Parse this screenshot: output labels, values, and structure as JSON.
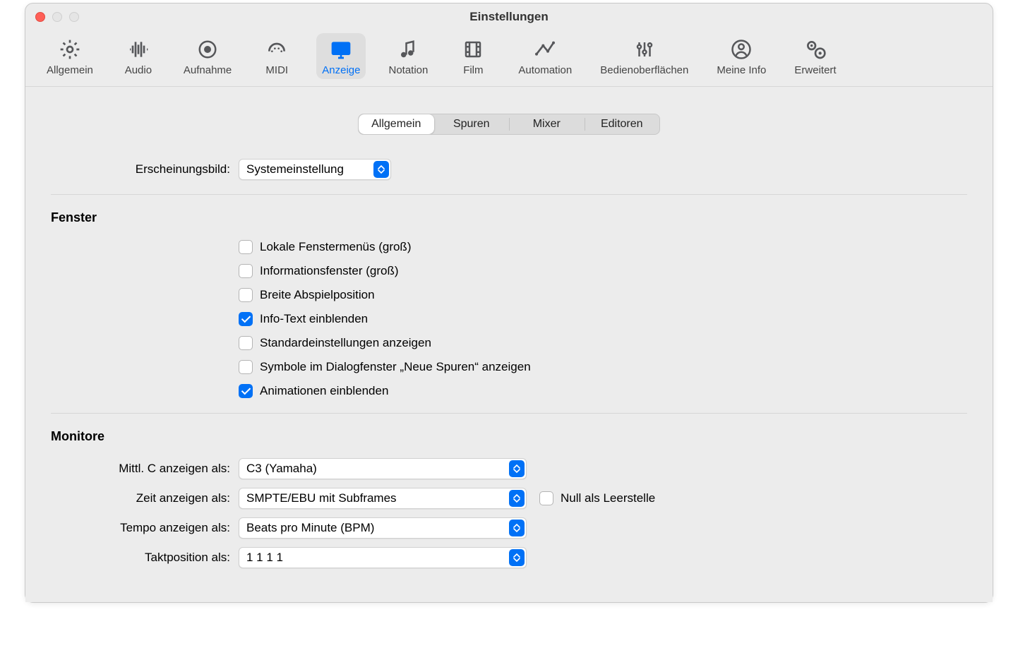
{
  "window": {
    "title": "Einstellungen"
  },
  "toolbar": {
    "items": [
      {
        "id": "general",
        "label": "Allgemein"
      },
      {
        "id": "audio",
        "label": "Audio"
      },
      {
        "id": "recording",
        "label": "Aufnahme"
      },
      {
        "id": "midi",
        "label": "MIDI"
      },
      {
        "id": "display",
        "label": "Anzeige",
        "active": true
      },
      {
        "id": "notation",
        "label": "Notation"
      },
      {
        "id": "film",
        "label": "Film"
      },
      {
        "id": "automation",
        "label": "Automation"
      },
      {
        "id": "surfaces",
        "label": "Bedienoberflächen"
      },
      {
        "id": "myinfo",
        "label": "Meine Info"
      },
      {
        "id": "advanced",
        "label": "Erweitert"
      }
    ]
  },
  "tabs": {
    "items": [
      {
        "id": "tab-general",
        "label": "Allgemein",
        "active": true
      },
      {
        "id": "tab-tracks",
        "label": "Spuren"
      },
      {
        "id": "tab-mixer",
        "label": "Mixer"
      },
      {
        "id": "tab-editors",
        "label": "Editoren"
      }
    ]
  },
  "appearance": {
    "label": "Erscheinungsbild:",
    "value": "Systemeinstellung"
  },
  "windows_section": {
    "title": "Fenster",
    "checkboxes": [
      {
        "id": "local-menus",
        "label": "Lokale Fenstermenüs (groß)",
        "checked": false
      },
      {
        "id": "info-window",
        "label": "Informationsfenster (groß)",
        "checked": false
      },
      {
        "id": "wide-playhead",
        "label": "Breite Abspielposition",
        "checked": false
      },
      {
        "id": "show-info",
        "label": "Info-Text einblenden",
        "checked": true
      },
      {
        "id": "show-defaults",
        "label": "Standardeinstellungen anzeigen",
        "checked": false
      },
      {
        "id": "new-tracks-icons",
        "label": "Symbole im Dialogfenster „Neue Spuren“ anzeigen",
        "checked": false
      },
      {
        "id": "show-anim",
        "label": "Animationen einblenden",
        "checked": true
      }
    ]
  },
  "monitors_section": {
    "title": "Monitore",
    "rows": {
      "middle_c": {
        "label": "Mittl. C anzeigen als:",
        "value": "C3 (Yamaha)"
      },
      "time": {
        "label": "Zeit anzeigen als:",
        "value": "SMPTE/EBU mit Subframes",
        "zero_as_blank": {
          "label": "Null als Leerstelle",
          "checked": false
        }
      },
      "tempo": {
        "label": "Tempo anzeigen als:",
        "value": "Beats pro Minute (BPM)"
      },
      "position": {
        "label": "Taktposition als:",
        "value": "1 1 1 1"
      }
    }
  }
}
